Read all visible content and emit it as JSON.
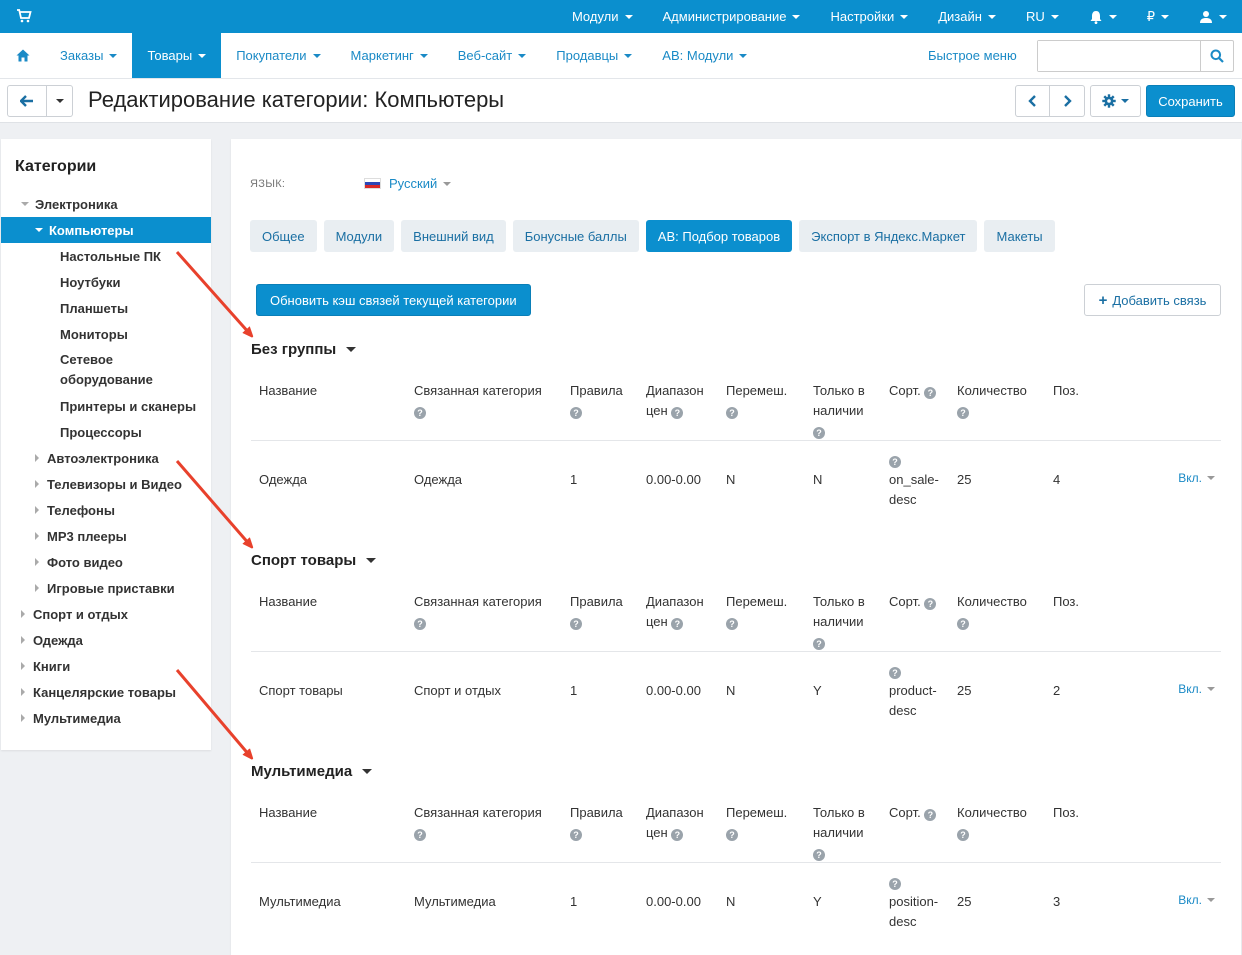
{
  "topbar": {
    "items": [
      {
        "label": "Модули",
        "caret": true
      },
      {
        "label": "Администрирование",
        "caret": true
      },
      {
        "label": "Настройки",
        "caret": true
      },
      {
        "label": "Дизайн",
        "caret": true
      },
      {
        "label": "RU",
        "caret": true
      },
      {
        "label": "bell-icon",
        "caret": true
      },
      {
        "label": "₽",
        "caret": true
      },
      {
        "label": "user-icon",
        "caret": true
      }
    ]
  },
  "navbar": {
    "items": [
      "Заказы",
      "Товары",
      "Покупатели",
      "Маркетинг",
      "Веб-сайт",
      "Продавцы",
      "AB: Модули"
    ],
    "active_index": 1,
    "quick_menu": "Быстрое меню",
    "search_value": ""
  },
  "actionbar": {
    "title": "Редактирование категории: Компьютеры",
    "save": "Сохранить"
  },
  "sidebar": {
    "title": "Категории",
    "items": [
      {
        "label": "Электроника",
        "level": 0,
        "state": "open"
      },
      {
        "label": "Компьютеры",
        "level": 1,
        "state": "open",
        "active": true
      },
      {
        "label": "Настольные ПК",
        "level": 2,
        "state": "leaf"
      },
      {
        "label": "Ноутбуки",
        "level": 2,
        "state": "leaf"
      },
      {
        "label": "Планшеты",
        "level": 2,
        "state": "leaf"
      },
      {
        "label": "Мониторы",
        "level": 2,
        "state": "leaf"
      },
      {
        "label": "Сетевое оборудование",
        "level": 2,
        "state": "leaf",
        "multi": true
      },
      {
        "label": "Принтеры и сканеры",
        "level": 2,
        "state": "leaf"
      },
      {
        "label": "Процессоры",
        "level": 2,
        "state": "leaf"
      },
      {
        "label": "Автоэлектроника",
        "level": 1,
        "state": "closed"
      },
      {
        "label": "Телевизоры и Видео",
        "level": 1,
        "state": "closed"
      },
      {
        "label": "Телефоны",
        "level": 1,
        "state": "closed"
      },
      {
        "label": "MP3 плееры",
        "level": 1,
        "state": "closed"
      },
      {
        "label": "Фото видео",
        "level": 1,
        "state": "closed"
      },
      {
        "label": "Игровые приставки",
        "level": 1,
        "state": "closed"
      },
      {
        "label": "Спорт и отдых",
        "level": 0,
        "state": "closed"
      },
      {
        "label": "Одежда",
        "level": 0,
        "state": "closed"
      },
      {
        "label": "Книги",
        "level": 0,
        "state": "closed"
      },
      {
        "label": "Канцелярские товары",
        "level": 0,
        "state": "closed"
      },
      {
        "label": "Мультимедиа",
        "level": 0,
        "state": "closed"
      }
    ]
  },
  "main": {
    "lang_label": "ЯЗЫК:",
    "lang_value": "Русский",
    "tabs": [
      "Общее",
      "Модули",
      "Внешний вид",
      "Бонусные баллы",
      "AB: Подбор товаров",
      "Экспорт в Яндекс.Маркет",
      "Макеты"
    ],
    "active_tab": 4,
    "refresh_button": "Обновить кэш связей текущей категории",
    "add_button": "Добавить связь",
    "columns": {
      "name": "Название",
      "linked": "Связанная категория",
      "rules": "Правила",
      "price_1": "Диапазон",
      "price_2": "цен",
      "shuffle": "Перемеш.",
      "stock_1": "Только в",
      "stock_2": "наличии",
      "sort": "Сорт.",
      "amount": "Количество",
      "pos": "Поз."
    },
    "groups": [
      {
        "title": "Без группы",
        "row": {
          "name": "Одежда",
          "linked": "Одежда",
          "rules": "1",
          "price": "0.00-0.00",
          "shuffle": "N",
          "stock": "N",
          "sort_1": "on_sale-",
          "sort_2": "desc",
          "amount": "25",
          "pos": "4",
          "status": "Вкл."
        }
      },
      {
        "title": "Спорт товары",
        "row": {
          "name": "Спорт товары",
          "linked": "Спорт и отдых",
          "rules": "1",
          "price": "0.00-0.00",
          "shuffle": "N",
          "stock": "Y",
          "sort_1": "product-",
          "sort_2": "desc",
          "amount": "25",
          "pos": "2",
          "status": "Вкл."
        }
      },
      {
        "title": "Мультимедиа",
        "row": {
          "name": "Мультимедиа",
          "linked": "Мультимедиа",
          "rules": "1",
          "price": "0.00-0.00",
          "shuffle": "N",
          "stock": "Y",
          "sort_1": "position-",
          "sort_2": "desc",
          "amount": "25",
          "pos": "3",
          "status": "Вкл."
        }
      }
    ]
  },
  "colors": {
    "primary": "#0b8fce",
    "link": "#1a8ac6",
    "arrow": "#e8412c"
  }
}
